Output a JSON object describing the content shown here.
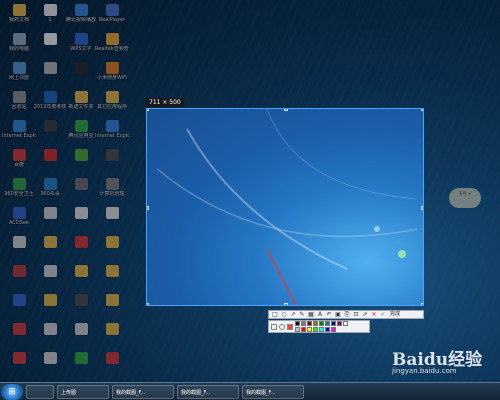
{
  "desktop": {
    "icons": [
      {
        "label": "我的文档",
        "color": "#f0c24b"
      },
      {
        "label": "1",
        "color": "#f6f6f6"
      },
      {
        "label": "腾讯视频播放",
        "color": "#3a8ee6"
      },
      {
        "label": "RealPlayer",
        "color": "#4a7bd6"
      },
      {
        "label": "我的电脑",
        "color": "#9fb7c9"
      },
      {
        "label": "",
        "color": "#ffffff"
      },
      {
        "label": "WPS文字",
        "color": "#3a6dd6"
      },
      {
        "label": "Realtek音频管理器",
        "color": "#ffb040"
      },
      {
        "label": "网上邻居",
        "color": "#5aa0d8"
      },
      {
        "label": "",
        "color": "#c0c0c0"
      },
      {
        "label": "",
        "color": "#2f2f2f"
      },
      {
        "label": "小米随身WiFi",
        "color": "#f08a24"
      },
      {
        "label": "回收站",
        "color": "#9a9a9a"
      },
      {
        "label": "2013年度考核",
        "color": "#1f6fc0"
      },
      {
        "label": "新建文件夹",
        "color": "#f0c24b"
      },
      {
        "label": "其它应用程序",
        "color": "#f0c24b"
      },
      {
        "label": "Internet Explorer",
        "color": "#3c8ae2"
      },
      {
        "label": "",
        "color": "#444"
      },
      {
        "label": "腾讯应用宝",
        "color": "#34b24a"
      },
      {
        "label": "Internet Explorer",
        "color": "#3c8ae2"
      },
      {
        "label": "百度",
        "color": "#e04040"
      },
      {
        "label": "",
        "color": "#dd3333"
      },
      {
        "label": "",
        "color": "#57b23a"
      },
      {
        "label": "",
        "color": "#555"
      },
      {
        "label": "360安全卫士",
        "color": "#3aa84a"
      },
      {
        "label": "360杀毒",
        "color": "#2c8ad8"
      },
      {
        "label": "",
        "color": "#777"
      },
      {
        "label": "计算机管理",
        "color": "#8a8a8a"
      },
      {
        "label": "ACDSee",
        "color": "#3a6dd6"
      },
      {
        "label": "",
        "color": "#dddddd"
      },
      {
        "label": "",
        "color": "#eeeeee"
      },
      {
        "label": "",
        "color": "#eeeeee"
      },
      {
        "label": "",
        "color": "#dddddd"
      },
      {
        "label": "",
        "color": "#f0c24b"
      },
      {
        "label": "",
        "color": "#e04040"
      },
      {
        "label": "",
        "color": "#f0c24b"
      },
      {
        "label": "",
        "color": "#c04040"
      },
      {
        "label": "",
        "color": "#dddddd"
      },
      {
        "label": "",
        "color": "#f0c24b"
      },
      {
        "label": "",
        "color": "#f0c24b"
      },
      {
        "label": "",
        "color": "#3a6dd6"
      },
      {
        "label": "",
        "color": "#f0c24b"
      },
      {
        "label": "",
        "color": "#555"
      },
      {
        "label": "",
        "color": "#f0c24b"
      },
      {
        "label": "",
        "color": "#e04040"
      },
      {
        "label": "",
        "color": "#dddddd"
      },
      {
        "label": "",
        "color": "#dddddd"
      },
      {
        "label": "",
        "color": "#f0c24b"
      },
      {
        "label": "",
        "color": "#e04040"
      },
      {
        "label": "",
        "color": "#dddddd"
      },
      {
        "label": "",
        "color": "#34b24a"
      },
      {
        "label": "",
        "color": "#e04040"
      }
    ],
    "gadget_text": "天气 ☀"
  },
  "capture": {
    "size_label": "711 × 500",
    "done_label": "完成",
    "toolbar_icons": [
      "rect-icon",
      "ellipse-icon",
      "arrow-icon",
      "pen-icon",
      "mosaic-icon",
      "text-icon",
      "undo-icon",
      "save-icon",
      "copy-icon",
      "pin-icon",
      "share-icon",
      "cancel-icon",
      "confirm-icon"
    ],
    "toolbar_glyphs": [
      "□",
      "○",
      "↗",
      "✎",
      "▦",
      "A",
      "↶",
      "▣",
      "⎘",
      "⊡",
      "⇗",
      "✕",
      "✓"
    ],
    "colors": [
      "#000000",
      "#808080",
      "#800000",
      "#808000",
      "#008000",
      "#008080",
      "#000080",
      "#800080",
      "#ffffff",
      "#c0c0c0",
      "#ff0000",
      "#ffff00",
      "#00ff00",
      "#00ffff",
      "#0000ff",
      "#ff00ff"
    ],
    "current_color": "#ff3b3b"
  },
  "taskbar": {
    "start_glyph": "⊞",
    "items": [
      "",
      "上传图",
      "我的截图_F...",
      "我的截图_F...",
      "我的截图_F..."
    ]
  },
  "watermark": {
    "brand": "Baidu经验",
    "url": "jingyan.baidu.com"
  }
}
